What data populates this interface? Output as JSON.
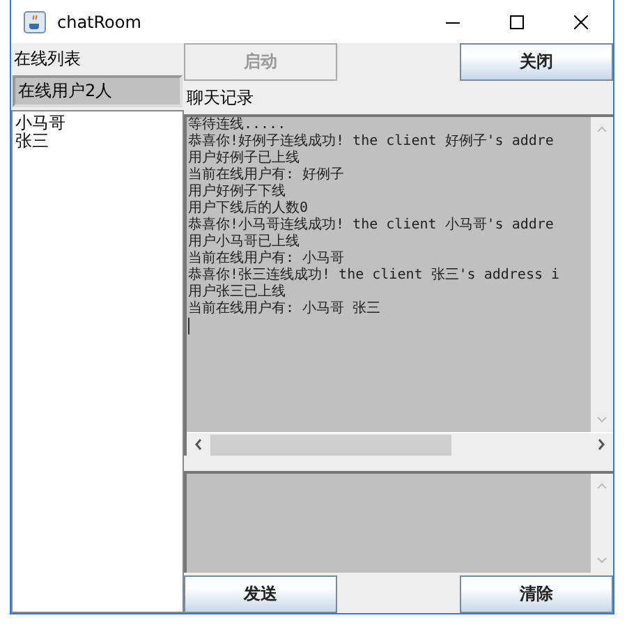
{
  "window": {
    "title": "chatRoom"
  },
  "online_panel": {
    "label": "在线列表",
    "count_field": {
      "value": "在线用户2人"
    },
    "users": [
      "小马哥",
      "张三"
    ]
  },
  "top_buttons": [
    {
      "label": "启动",
      "disabled": true
    },
    {
      "label": "关闭",
      "disabled": false
    }
  ],
  "chat_log": {
    "label": "聊天记录",
    "lines": [
      "等待连线.....",
      "恭喜你!好例子连线成功! the client 好例子's addre",
      "用户好例子已上线",
      "当前在线用户有: 好例子",
      "用户好例子下线",
      "用户下线后的人数0",
      "恭喜你!小马哥连线成功! the client 小马哥's addre",
      "用户小马哥已上线",
      "当前在线用户有: 小马哥",
      "恭喜你!张三连线成功! the client 张三's address i",
      "用户张三已上线",
      "当前在线用户有: 小马哥 张三"
    ]
  },
  "bottom_buttons": [
    {
      "label": "发送",
      "disabled": false
    },
    {
      "label": "清除",
      "disabled": false
    }
  ]
}
